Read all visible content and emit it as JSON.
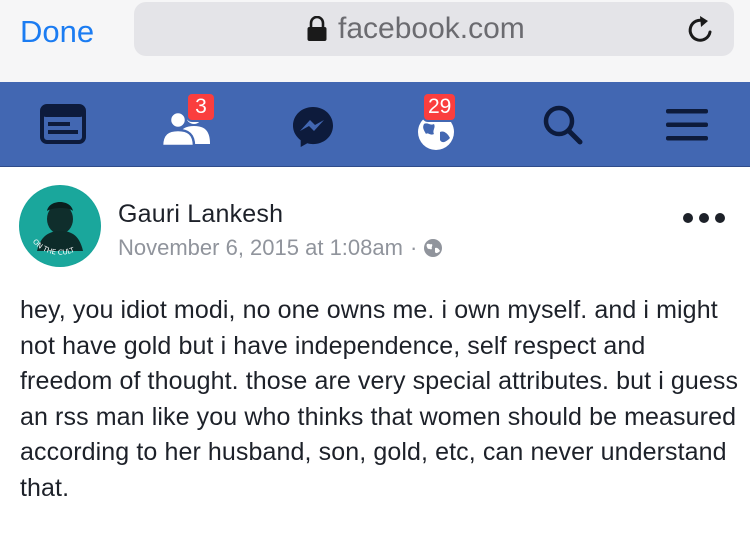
{
  "browser": {
    "done_label": "Done",
    "url": "facebook.com",
    "icons": {
      "lock": "lock-icon",
      "reload": "reload-icon"
    }
  },
  "nav": {
    "items": [
      {
        "name": "news-feed",
        "icon": "news-feed-icon"
      },
      {
        "name": "friend-requests",
        "icon": "friends-icon",
        "badge": "3"
      },
      {
        "name": "messenger",
        "icon": "messenger-icon"
      },
      {
        "name": "notifications",
        "icon": "globe-icon",
        "badge": "29"
      },
      {
        "name": "search",
        "icon": "search-icon"
      },
      {
        "name": "menu",
        "icon": "menu-icon"
      }
    ],
    "colors": {
      "bar": "#4267b2",
      "badge": "#fa3e3e"
    }
  },
  "post": {
    "author": "Gauri Lankesh",
    "timestamp": "November 6, 2015 at 1:08am",
    "separator": "·",
    "privacy_icon": "public-globe-icon",
    "avatar_text": "ON THE CULT",
    "text": "hey, you idiot modi, no one owns me. i own myself. and i might not have gold but i have independence, self respect and freedom of thought. those are very special attributes. but i guess an rss man like you who thinks that women should be measured according to her husband, son, gold, etc, can never understand that."
  },
  "colors": {
    "link": "#1b7cf2",
    "text": "#1d2129",
    "meta": "#90949c"
  }
}
